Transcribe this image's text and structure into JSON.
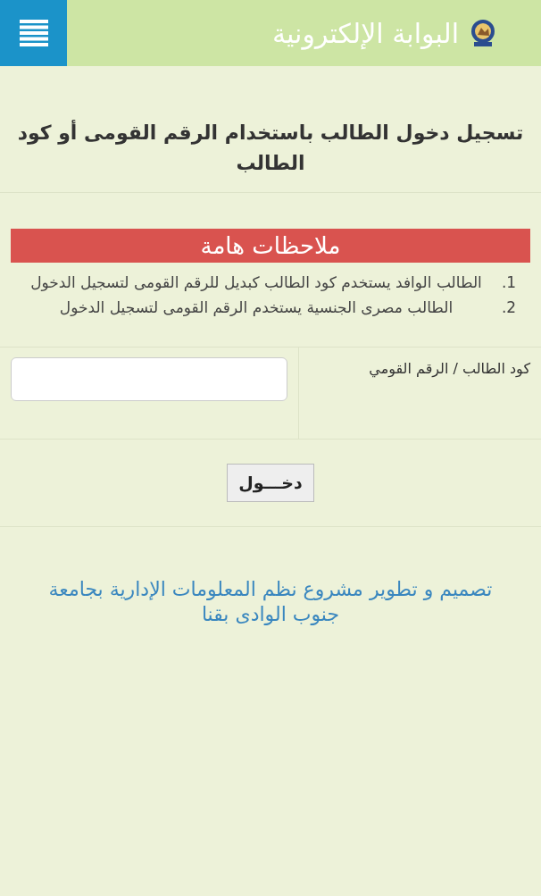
{
  "header": {
    "title": "البوابة الإلكترونية"
  },
  "page_title": "تسجيل دخول الطالب باستخدام الرقم القومى أو كود الطالب",
  "notes": {
    "heading": "ملاحظات هامة",
    "items": [
      {
        "number": "1.",
        "text": "الطالب الوافد يستخدم كود الطالب كبديل للرقم القومى لتسجيل الدخول"
      },
      {
        "number": "2.",
        "text": "الطالب مصرى الجنسية يستخدم الرقم القومى لتسجيل الدخول"
      }
    ]
  },
  "form": {
    "field_label": "كود الطالب / الرقم القومي",
    "submit": "دخـــول"
  },
  "footer": "تصميم و تطوير مشروع نظم المعلومات الإدارية بجامعة جنوب الوادى بقنا"
}
